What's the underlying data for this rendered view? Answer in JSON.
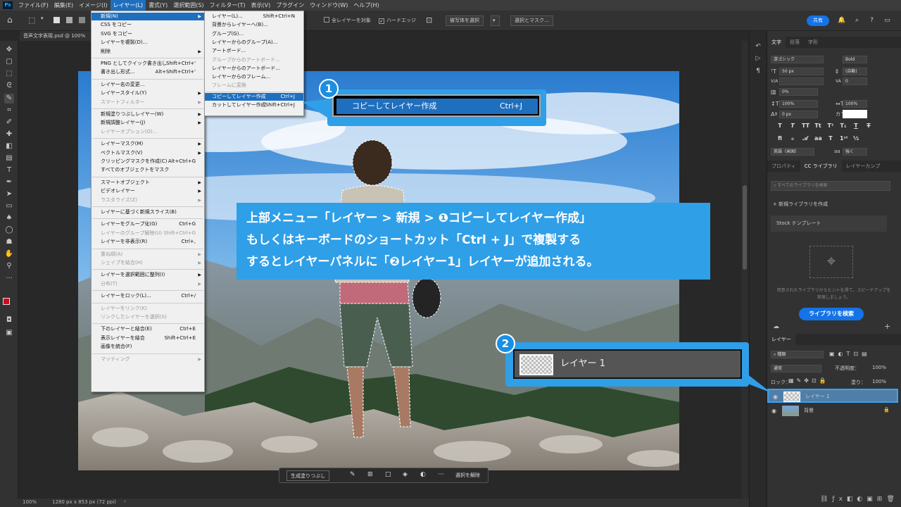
{
  "menubar": {
    "items": [
      "ファイル(F)",
      "編集(E)",
      "イメージ(I)",
      "レイヤー(L)",
      "書式(Y)",
      "選択範囲(S)",
      "フィルター(T)",
      "表示(V)",
      "プラグイン",
      "ウィンドウ(W)",
      "ヘルプ(H)"
    ],
    "active_index": 3
  },
  "options_bar": {
    "all_layers_label": "全レイヤーを対象",
    "hard_edge_label": "ハードエッジ",
    "select_subject_label": "被写体を選択",
    "select_mask_label": "選択とマスク...",
    "share_label": "共有"
  },
  "document": {
    "tab_title": "音声文字表現.psd @ 100%",
    "zoom": "100%",
    "dimensions": "1280 px x 853 px (72 ppi)"
  },
  "layer_menu": {
    "items": [
      {
        "label": "新規(N)",
        "shortcut": "",
        "arrow": true,
        "state": "hl"
      },
      {
        "label": "CSS をコピー",
        "shortcut": "",
        "arrow": false,
        "state": ""
      },
      {
        "label": "SVG をコピー",
        "shortcut": "",
        "arrow": false,
        "state": ""
      },
      {
        "label": "レイヤーを複製(D)...",
        "shortcut": "",
        "arrow": false,
        "state": ""
      },
      {
        "label": "削除",
        "shortcut": "",
        "arrow": true,
        "state": ""
      },
      {
        "label": "-"
      },
      {
        "label": "PNG としてクイック書き出し",
        "shortcut": "Shift+Ctrl+'",
        "arrow": false,
        "state": ""
      },
      {
        "label": "書き出し形式...",
        "shortcut": "Alt+Shift+Ctrl+'",
        "arrow": false,
        "state": ""
      },
      {
        "label": "-"
      },
      {
        "label": "レイヤー名の変更...",
        "shortcut": "",
        "arrow": false,
        "state": ""
      },
      {
        "label": "レイヤースタイル(Y)",
        "shortcut": "",
        "arrow": true,
        "state": ""
      },
      {
        "label": "スマートフィルター",
        "shortcut": "",
        "arrow": true,
        "state": "dis"
      },
      {
        "label": "-"
      },
      {
        "label": "新規塗りつぶしレイヤー(W)",
        "shortcut": "",
        "arrow": true,
        "state": ""
      },
      {
        "label": "新規調整レイヤー(J)",
        "shortcut": "",
        "arrow": true,
        "state": ""
      },
      {
        "label": "レイヤーオプション(O)...",
        "shortcut": "",
        "arrow": false,
        "state": "dis"
      },
      {
        "label": "-"
      },
      {
        "label": "レイヤーマスク(M)",
        "shortcut": "",
        "arrow": true,
        "state": ""
      },
      {
        "label": "ベクトルマスク(V)",
        "shortcut": "",
        "arrow": true,
        "state": ""
      },
      {
        "label": "クリッピングマスクを作成(C)",
        "shortcut": "Alt+Ctrl+G",
        "arrow": false,
        "state": ""
      },
      {
        "label": "すべてのオブジェクトをマスク",
        "shortcut": "",
        "arrow": false,
        "state": ""
      },
      {
        "label": "-"
      },
      {
        "label": "スマートオブジェクト",
        "shortcut": "",
        "arrow": true,
        "state": ""
      },
      {
        "label": "ビデオレイヤー",
        "shortcut": "",
        "arrow": true,
        "state": ""
      },
      {
        "label": "ラスタライズ(Z)",
        "shortcut": "",
        "arrow": true,
        "state": "dis"
      },
      {
        "label": "-"
      },
      {
        "label": "レイヤーに基づく新規スライス(B)",
        "shortcut": "",
        "arrow": false,
        "state": ""
      },
      {
        "label": "-"
      },
      {
        "label": "レイヤーをグループ化(G)",
        "shortcut": "Ctrl+G",
        "arrow": false,
        "state": ""
      },
      {
        "label": "レイヤーのグループ解除(U)",
        "shortcut": "Shift+Ctrl+G",
        "arrow": false,
        "state": "dis"
      },
      {
        "label": "レイヤーを非表示(R)",
        "shortcut": "Ctrl+,",
        "arrow": false,
        "state": ""
      },
      {
        "label": "-"
      },
      {
        "label": "重ね順(A)",
        "shortcut": "",
        "arrow": true,
        "state": "dis"
      },
      {
        "label": "シェイプを結合(H)",
        "shortcut": "",
        "arrow": true,
        "state": "dis"
      },
      {
        "label": "-"
      },
      {
        "label": "レイヤーを選択範囲に整列(I)",
        "shortcut": "",
        "arrow": true,
        "state": ""
      },
      {
        "label": "分布(T)",
        "shortcut": "",
        "arrow": true,
        "state": "dis"
      },
      {
        "label": "-"
      },
      {
        "label": "レイヤーをロック(L)...",
        "shortcut": "Ctrl+/",
        "arrow": false,
        "state": ""
      },
      {
        "label": "-"
      },
      {
        "label": "レイヤーをリンク(K)",
        "shortcut": "",
        "arrow": false,
        "state": "dis"
      },
      {
        "label": "リンクしたレイヤーを選択(S)",
        "shortcut": "",
        "arrow": false,
        "state": "dis"
      },
      {
        "label": "-"
      },
      {
        "label": "下のレイヤーと結合(E)",
        "shortcut": "Ctrl+E",
        "arrow": false,
        "state": ""
      },
      {
        "label": "表示レイヤーを結合",
        "shortcut": "Shift+Ctrl+E",
        "arrow": false,
        "state": ""
      },
      {
        "label": "画像を統合(F)",
        "shortcut": "",
        "arrow": false,
        "state": ""
      },
      {
        "label": "-"
      },
      {
        "label": "マッティング",
        "shortcut": "",
        "arrow": true,
        "state": "dis"
      }
    ]
  },
  "new_submenu": {
    "items": [
      {
        "label": "レイヤー(L)...",
        "shortcut": "Shift+Ctrl+N",
        "state": ""
      },
      {
        "label": "背景からレイヤーへ(B)...",
        "shortcut": "",
        "state": ""
      },
      {
        "label": "グループ(G)...",
        "shortcut": "",
        "state": ""
      },
      {
        "label": "レイヤーからのグループ(A)...",
        "shortcut": "",
        "state": ""
      },
      {
        "label": "アートボード...",
        "shortcut": "",
        "state": ""
      },
      {
        "label": "グループからのアートボード...",
        "shortcut": "",
        "state": "dis"
      },
      {
        "label": "レイヤーからのアートボード...",
        "shortcut": "",
        "state": ""
      },
      {
        "label": "レイヤーからのフレーム...",
        "shortcut": "",
        "state": ""
      },
      {
        "label": "フレームに変換",
        "shortcut": "",
        "state": "dis"
      },
      {
        "label": "-"
      },
      {
        "label": "コピーしてレイヤー作成",
        "shortcut": "Ctrl+J",
        "state": "hl"
      },
      {
        "label": "カットしてレイヤー作成",
        "shortcut": "Shift+Ctrl+J",
        "state": ""
      }
    ]
  },
  "annotations": {
    "badge1": "1",
    "badge2": "2",
    "callout1_label": "コピーしてレイヤー作成",
    "callout1_shortcut": "Ctrl+J",
    "banner_line1": "上部メニュー「レイヤー > 新規 > ❶コピーしてレイヤー作成」",
    "banner_line2": "もしくはキーボードのショートカット「Ctrl + J」で複製する",
    "banner_line3": "するとレイヤーパネルに「❷レイヤー1」レイヤーが追加される。",
    "callout2_label": "レイヤー 1"
  },
  "character_panel": {
    "tabs": [
      "文字",
      "段落",
      "字形"
    ],
    "font_family": "游ゴシック",
    "font_style": "Bold",
    "font_size": "50 px",
    "leading": "(自動)",
    "tracking": "0",
    "kerning": "",
    "tsume": "0%",
    "vscale": "100%",
    "hscale": "100%",
    "baseline": "0 px",
    "color_label": "カラー：",
    "language": "英語（米国）",
    "aa_label": "aa",
    "antialias": "強く"
  },
  "library_panel": {
    "tabs": [
      "プロパティ",
      "CC ライブラリ",
      "レイヤーカンプ"
    ],
    "search_placeholder": "すべてのライブラリを検索",
    "new_library": "+ 新規ライブラリを作成",
    "stock_template": "Stock テンプレート",
    "hint": "用意されたライブラリからヒントを得て、スピードアップを実現しましょう。",
    "search_button": "ライブラリを検索"
  },
  "layers_panel": {
    "tab": "レイヤー",
    "filter_kind": "種類",
    "blend_mode": "通常",
    "opacity_label": "不透明度：",
    "opacity": "100%",
    "lock_label": "ロック：",
    "fill_label": "塗り：",
    "fill": "100%",
    "layers": [
      {
        "name": "レイヤー 1",
        "selected": true,
        "locked": false
      },
      {
        "name": "背景",
        "selected": false,
        "locked": true
      }
    ]
  },
  "context_bar": {
    "generate_label": "生成塗りつぶし",
    "deselect_label": "選択を解除"
  },
  "colors": {
    "accent": "#2f9fe8",
    "menu_highlight": "#1f6fbf",
    "foreground": "#d1081e",
    "background": "#ffffff"
  }
}
